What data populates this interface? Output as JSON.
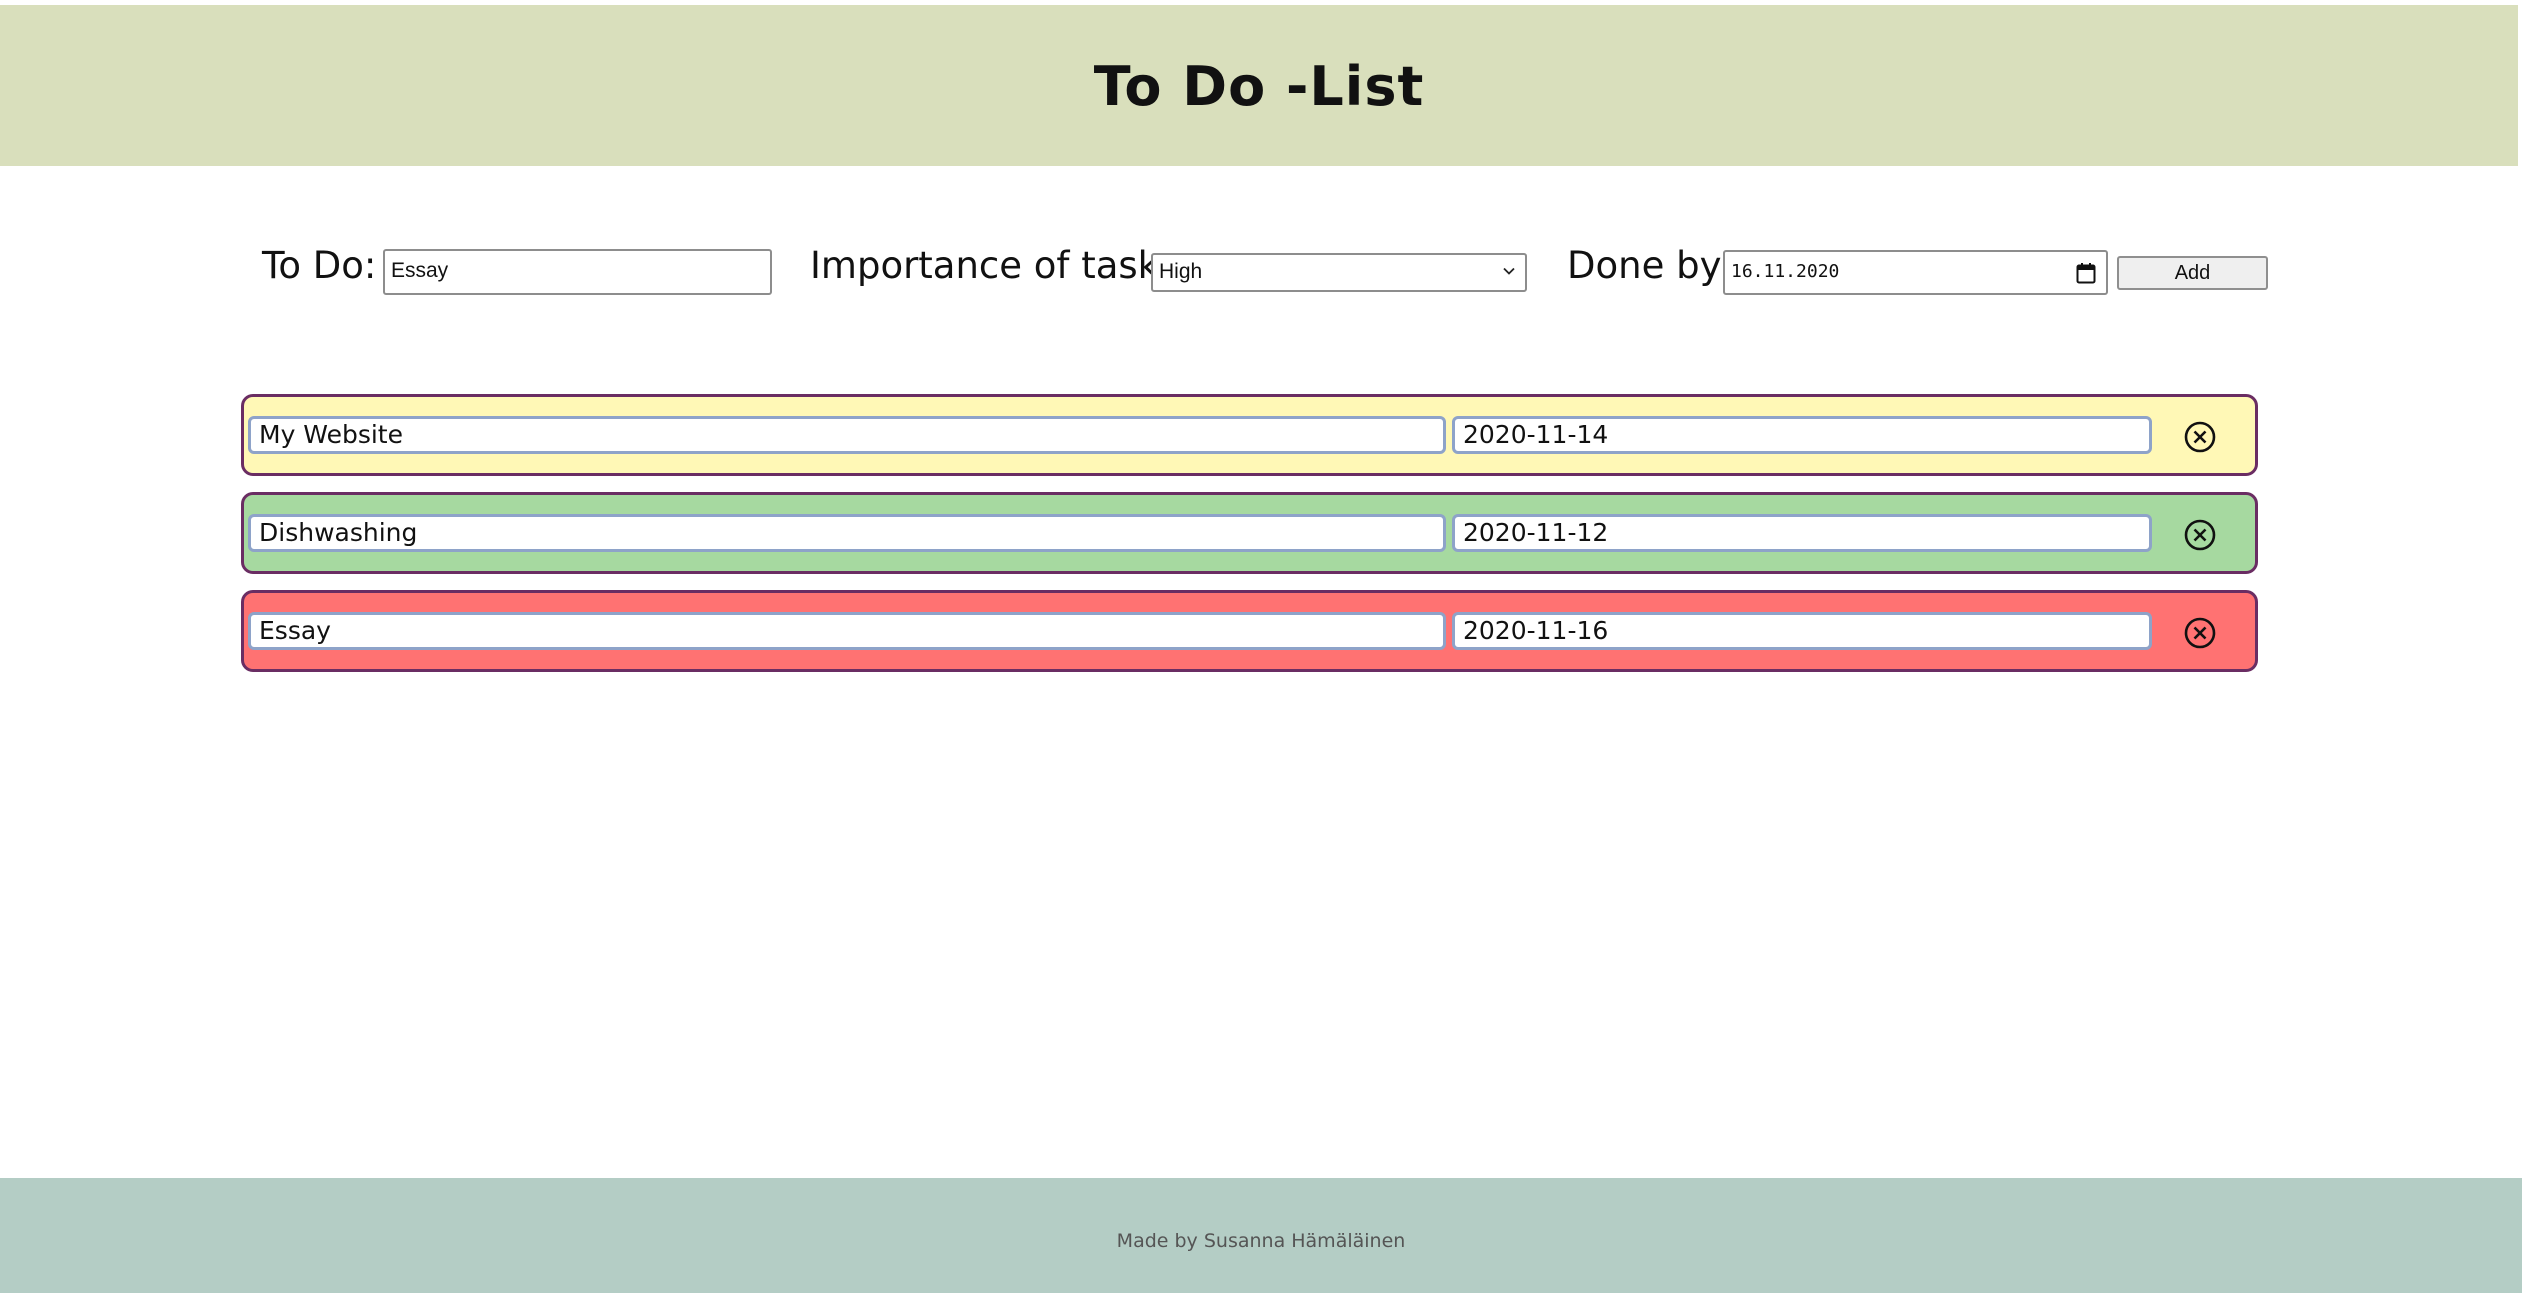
{
  "header": {
    "title": "To Do -List"
  },
  "form": {
    "todo_label": "To Do:",
    "todo_value": "Essay",
    "importance_label": "Importance of task:",
    "importance_selected": "High",
    "done_by_label": "Done by:",
    "done_by_value": "16.11.2020",
    "add_label": "Add"
  },
  "todos": [
    {
      "task": "My Website",
      "date": "2020-11-14",
      "color": "#fff8b6"
    },
    {
      "task": "Dishwashing",
      "date": "2020-11-12",
      "color": "#a6d9a0"
    },
    {
      "task": "Essay",
      "date": "2020-11-16",
      "color": "#ff7272"
    }
  ],
  "icons": {
    "remove": "close-circle-icon",
    "select": "chevron-down-icon",
    "date": "calendar-icon"
  },
  "footer": {
    "credit": "Made by Susanna Hämäläinen"
  },
  "colors": {
    "header_bg": "#d9dfbc",
    "footer_bg": "#b4cdc5",
    "row_border": "#6a2d63",
    "field_border": "#8ea3c9"
  }
}
